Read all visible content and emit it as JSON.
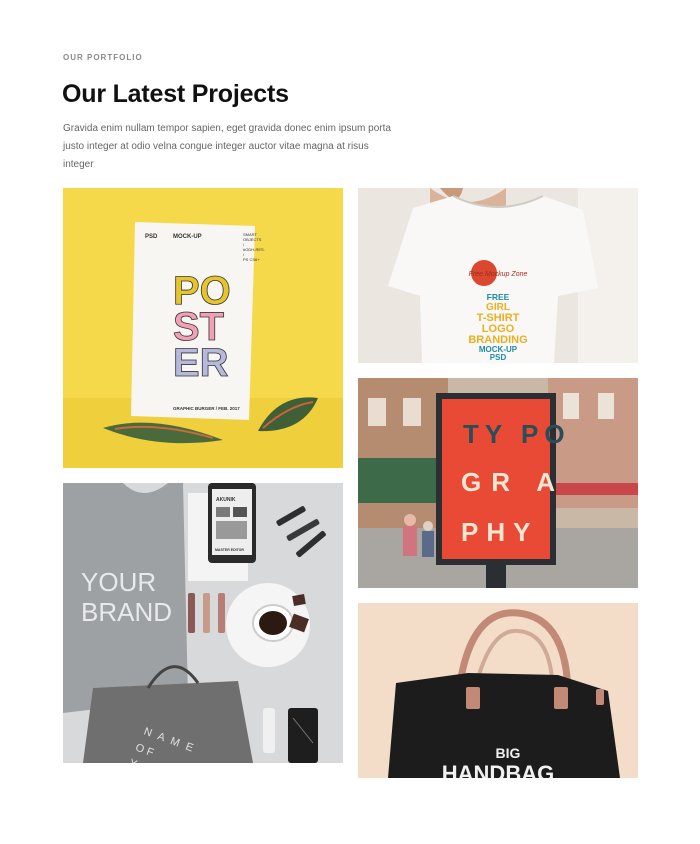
{
  "section": {
    "eyebrow": "OUR PORTFOLIO",
    "title": "Our Latest Projects",
    "description": "Gravida enim nullam tempor sapien, eget gravida donec enim ipsum porta justo integer at odio velna congue integer auctor vitae magna at risus integer"
  },
  "projects": {
    "poster": {
      "psd": "PSD",
      "mockup": "MOCK-UP",
      "specs": [
        "SMART",
        "OBJECTS",
        "/",
        "#ODH-RES.",
        "/",
        "PS CS6+"
      ],
      "letters": [
        "PO",
        "ST",
        "ER"
      ],
      "footer": "GRAPHIC BURGER / FEB. 2017"
    },
    "tshirt": {
      "logo": "Free Mockup Zone",
      "lines": [
        "FREE",
        "GIRL",
        "T-SHIRT",
        "LOGO",
        "BRANDING",
        "MOCK-UP",
        "PSD"
      ]
    },
    "typography": {
      "lines": [
        "TY PO",
        "GR A",
        "PHY"
      ]
    },
    "brand": {
      "shirt_text": [
        "YOUR",
        "BRAND"
      ],
      "bag_text": [
        "N A M E",
        "O F",
        "Y"
      ],
      "tablet_text": [
        "AKUNIK",
        "MASTER EDITOR"
      ]
    },
    "handbag": {
      "lines": [
        "BIG",
        "HANDBAG"
      ]
    }
  }
}
